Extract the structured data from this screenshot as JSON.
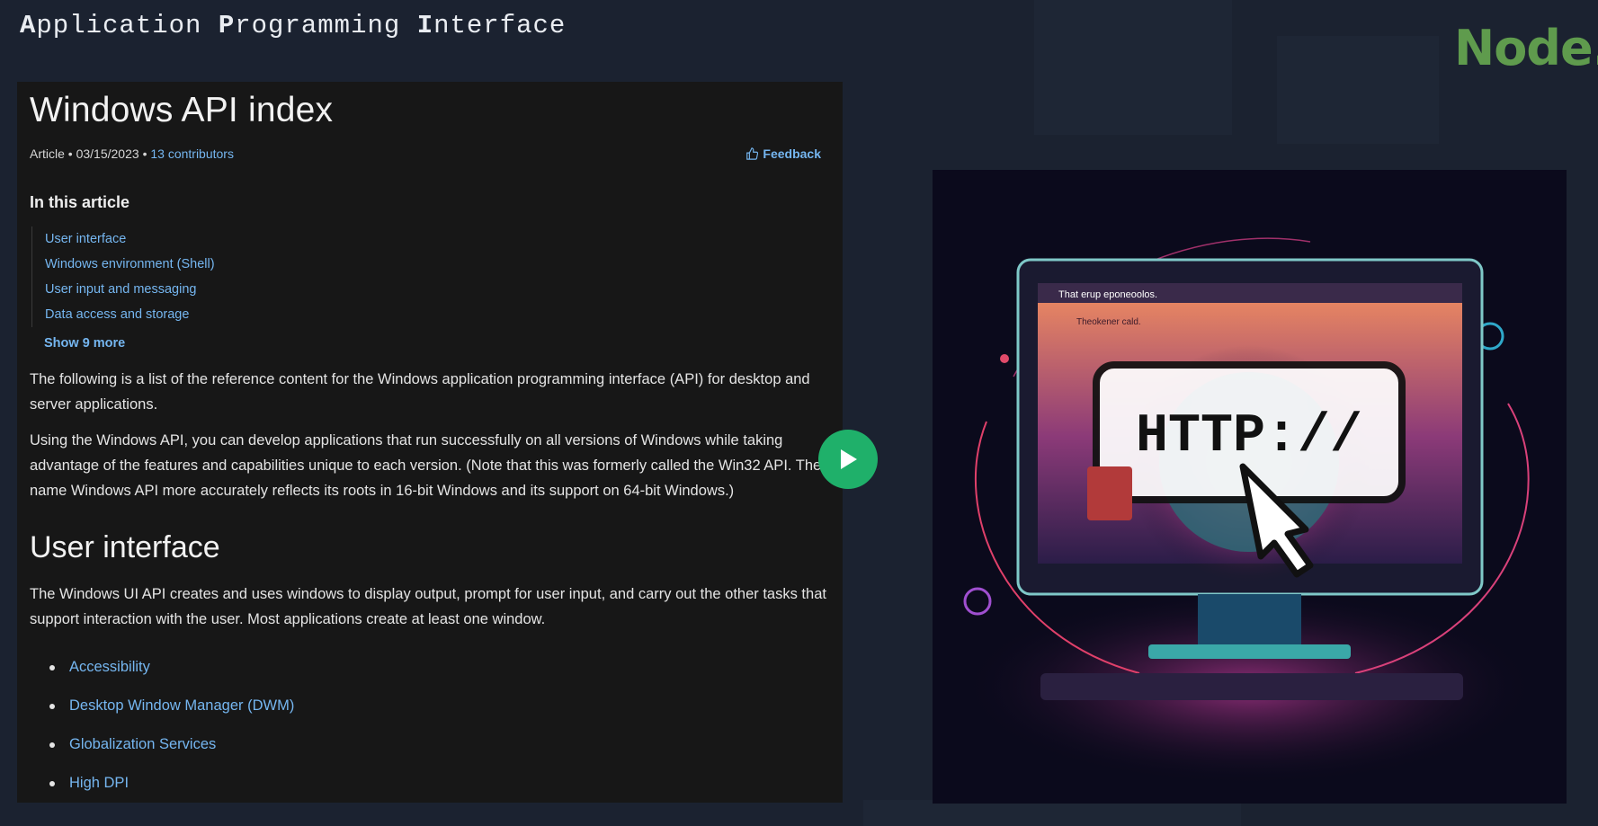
{
  "slide": {
    "title_parts": [
      {
        "initial": "A",
        "rest": "pplication "
      },
      {
        "initial": "P",
        "rest": "rogramming "
      },
      {
        "initial": "I",
        "rest": "nterface"
      }
    ],
    "brand": "Node."
  },
  "doc": {
    "title": "Windows API index",
    "meta": {
      "type": "Article",
      "date": "03/15/2023",
      "contributors": "13 contributors",
      "feedback": "Feedback"
    },
    "toc_heading": "In this article",
    "toc_items": [
      "User interface",
      "Windows environment (Shell)",
      "User input and messaging",
      "Data access and storage"
    ],
    "show_more": "Show 9 more",
    "paragraphs": [
      "The following is a list of the reference content for the Windows application programming interface (API) for desktop and server applications.",
      "Using the Windows API, you can develop applications that run successfully on all versions of Windows while taking advantage of the features and capabilities unique to each version. (Note that this was formerly called the Win32 API. The name Windows API more accurately reflects its roots in 16-bit Windows and its support on 64-bit Windows.)"
    ],
    "section_heading": "User interface",
    "section_text": "The Windows UI API creates and uses windows to display output, prompt for user input, and carry out the other tasks that support interaction with the user. Most applications create at least one window.",
    "api_links": [
      "Accessibility",
      "Desktop Window Manager (DWM)",
      "Globalization Services",
      "High DPI"
    ]
  },
  "illustration": {
    "browser_title": "That erup eponeoolos.",
    "banner_text": "Theokener cald.",
    "http_text": "HTTP://"
  },
  "colors": {
    "background": "#1b2230",
    "doc_background": "#171717",
    "link": "#75b6f0",
    "brand_green": "#5f9b4d",
    "play_green": "#1fb06a"
  },
  "icons": {
    "feedback": "thumbs-up-icon",
    "play": "play-icon"
  }
}
